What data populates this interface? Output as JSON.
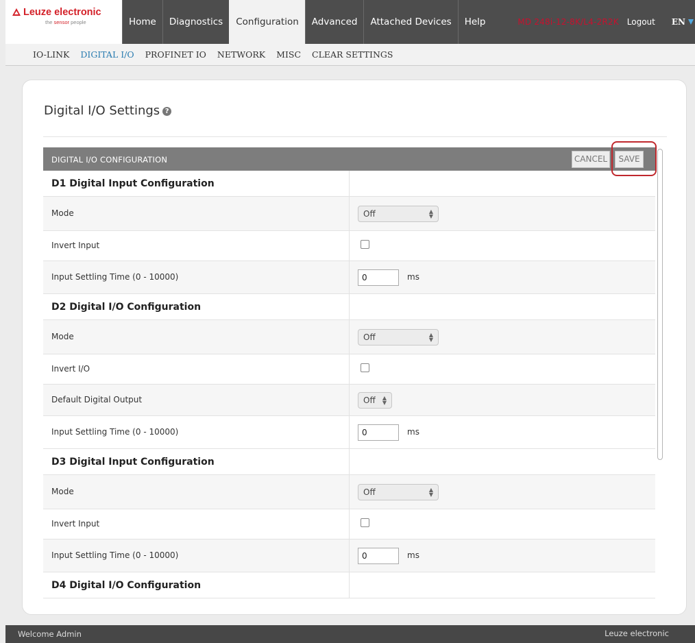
{
  "header": {
    "brand": "Leuze electronic",
    "tagline_pre": "the ",
    "tagline_accent": "sensor",
    "tagline_post": " people",
    "tabs": [
      {
        "label": "Home",
        "active": false
      },
      {
        "label": "Diagnostics",
        "active": false
      },
      {
        "label": "Configuration",
        "active": true
      },
      {
        "label": "Advanced",
        "active": false
      },
      {
        "label": "Attached Devices",
        "active": false
      },
      {
        "label": "Help",
        "active": false
      }
    ],
    "device_name": "MD 248i-12-8K/L4-2R2K",
    "logout": "Logout",
    "language": "EN"
  },
  "subnav": [
    {
      "label": "IO-LINK",
      "active": false
    },
    {
      "label": "DIGITAL I/O",
      "active": true
    },
    {
      "label": "PROFINET IO",
      "active": false
    },
    {
      "label": "NETWORK",
      "active": false
    },
    {
      "label": "MISC",
      "active": false
    },
    {
      "label": "CLEAR SETTINGS",
      "active": false
    }
  ],
  "page": {
    "title": "Digital I/O Settings",
    "panel_title": "DIGITAL I/O CONFIGURATION",
    "cancel_label": "CANCEL",
    "save_label": "SAVE"
  },
  "sections": [
    {
      "title": "D1 Digital Input Configuration",
      "rows": [
        {
          "label": "Mode",
          "type": "select",
          "value": "Off"
        },
        {
          "label": "Invert Input",
          "type": "checkbox",
          "checked": false
        },
        {
          "label": "Input Settling Time (0 - 10000)",
          "type": "number",
          "value": "0",
          "unit": "ms"
        }
      ]
    },
    {
      "title": "D2 Digital I/O Configuration",
      "rows": [
        {
          "label": "Mode",
          "type": "select",
          "value": "Off"
        },
        {
          "label": "Invert I/O",
          "type": "checkbox",
          "checked": false
        },
        {
          "label": "Default Digital Output",
          "type": "select-small",
          "value": "Off"
        },
        {
          "label": "Input Settling Time (0 - 10000)",
          "type": "number",
          "value": "0",
          "unit": "ms"
        }
      ]
    },
    {
      "title": "D3 Digital Input Configuration",
      "rows": [
        {
          "label": "Mode",
          "type": "select",
          "value": "Off"
        },
        {
          "label": "Invert Input",
          "type": "checkbox",
          "checked": false
        },
        {
          "label": "Input Settling Time (0 - 10000)",
          "type": "number",
          "value": "0",
          "unit": "ms"
        }
      ]
    },
    {
      "title": "D4 Digital I/O Configuration",
      "rows": []
    }
  ],
  "footer": {
    "left": "Welcome Admin",
    "right": "Leuze electronic"
  }
}
